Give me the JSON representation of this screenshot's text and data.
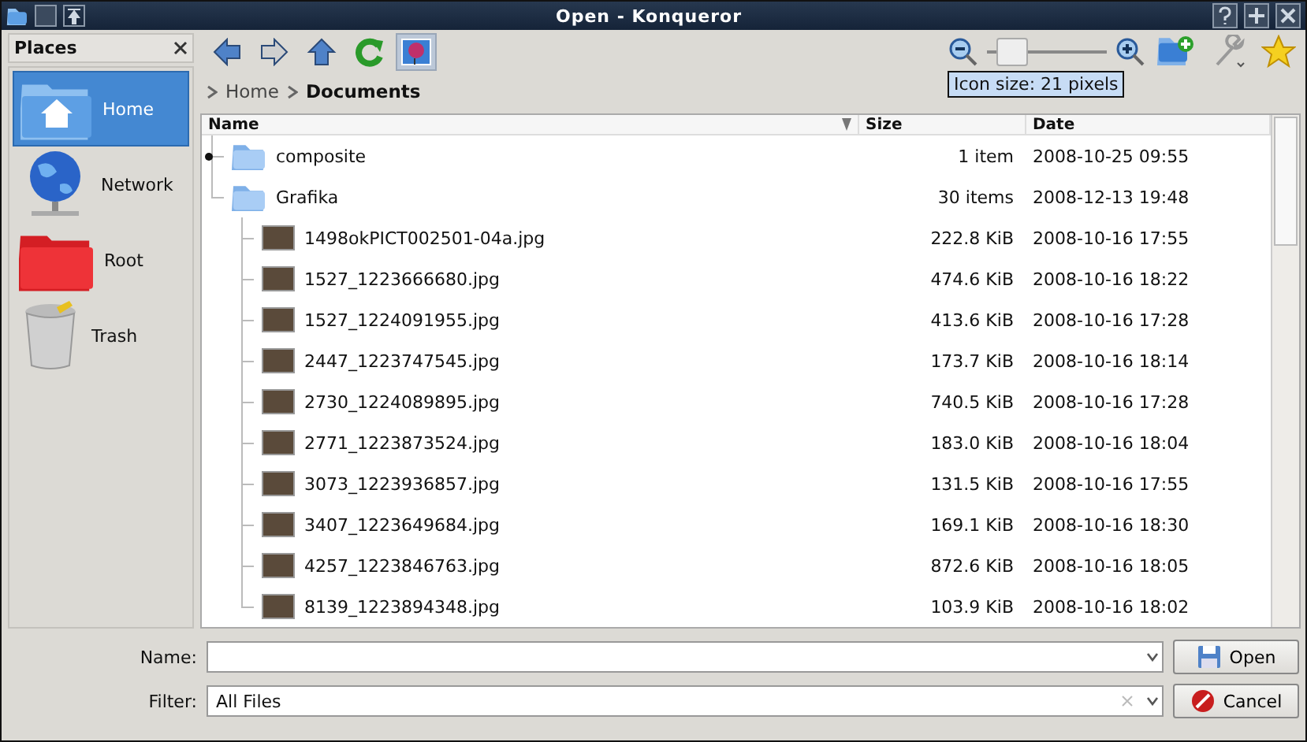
{
  "window": {
    "title": "Open - Konqueror"
  },
  "places": {
    "title": "Places",
    "items": [
      {
        "label": "Home",
        "kind": "home",
        "selected": true
      },
      {
        "label": "Network",
        "kind": "network",
        "selected": false
      },
      {
        "label": "Root",
        "kind": "root",
        "selected": false
      },
      {
        "label": "Trash",
        "kind": "trash",
        "selected": false
      }
    ]
  },
  "toolbar": {
    "back_disabled": false,
    "forward_disabled": true,
    "preview_on": true,
    "zoom": {
      "level": 0.1
    },
    "tooltip": "Icon size: 21 pixels"
  },
  "breadcrumb": [
    {
      "label": "Home",
      "current": false
    },
    {
      "label": "Documents",
      "current": true
    }
  ],
  "table": {
    "columns": [
      "Name",
      "Size",
      "Date"
    ],
    "rows": [
      {
        "name": "composite",
        "kind": "folder",
        "expanded": false,
        "size": "1 item",
        "date": "2008-10-25 09:55"
      },
      {
        "name": "Grafika",
        "kind": "folder",
        "expanded": true,
        "size": "30 items",
        "date": "2008-12-13 19:48",
        "children": [
          {
            "name": "1498okPICT002501-04a.jpg",
            "kind": "image",
            "size": "222.8 KiB",
            "date": "2008-10-16 17:55"
          },
          {
            "name": "1527_1223666680.jpg",
            "kind": "image",
            "size": "474.6 KiB",
            "date": "2008-10-16 18:22"
          },
          {
            "name": "1527_1224091955.jpg",
            "kind": "image",
            "size": "413.6 KiB",
            "date": "2008-10-16 17:28"
          },
          {
            "name": "2447_1223747545.jpg",
            "kind": "image",
            "size": "173.7 KiB",
            "date": "2008-10-16 18:14"
          },
          {
            "name": "2730_1224089895.jpg",
            "kind": "image",
            "size": "740.5 KiB",
            "date": "2008-10-16 17:28"
          },
          {
            "name": "2771_1223873524.jpg",
            "kind": "image",
            "size": "183.0 KiB",
            "date": "2008-10-16 18:04"
          },
          {
            "name": "3073_1223936857.jpg",
            "kind": "image",
            "size": "131.5 KiB",
            "date": "2008-10-16 17:55"
          },
          {
            "name": "3407_1223649684.jpg",
            "kind": "image",
            "size": "169.1 KiB",
            "date": "2008-10-16 18:30"
          },
          {
            "name": "4257_1223846763.jpg",
            "kind": "image",
            "size": "872.6 KiB",
            "date": "2008-10-16 18:05"
          },
          {
            "name": "8139_1223894348.jpg",
            "kind": "image",
            "size": "103.9 KiB",
            "date": "2008-10-16 18:02"
          }
        ]
      }
    ]
  },
  "name_field": {
    "label": "Name:"
  },
  "filter_field": {
    "label": "Filter:",
    "value": "All Files"
  },
  "buttons": [
    {
      "label": "Open",
      "kind": "open"
    },
    {
      "label": "Cancel",
      "kind": "cancel"
    }
  ]
}
